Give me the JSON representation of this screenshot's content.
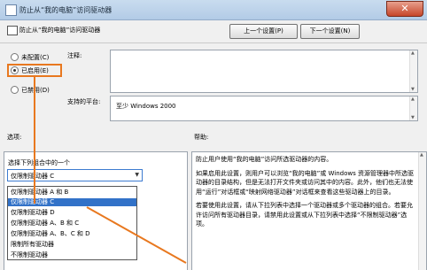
{
  "window": {
    "title": "防止从“我的电脑”访问驱动器",
    "close_glyph": "✕"
  },
  "header": {
    "title": "防止从“我的电脑”访问驱动器"
  },
  "nav": {
    "prev_label": "上一个设置(P)",
    "next_label": "下一个设置(N)"
  },
  "state_options": [
    {
      "label": "未配置(C)",
      "selected": false
    },
    {
      "label": "已启用(E)",
      "selected": true
    },
    {
      "label": "已禁用(D)",
      "selected": false
    }
  ],
  "comment": {
    "label": "注释:",
    "value": ""
  },
  "supported": {
    "label": "支持的平台:",
    "value": "至少 Windows 2000"
  },
  "options_heading": "选项:",
  "help_heading": "帮助:",
  "options": {
    "prompt": "选择下列组合中的一个",
    "selected_value": "仅限制驱动器 C",
    "dropdown_items": [
      "仅限制驱动器 A 和 B",
      "仅限制驱动器 C",
      "仅限制驱动器 D",
      "仅限制驱动器 A、B 和 C",
      "仅限制驱动器 A、B、C 和 D",
      "限制所有驱动器",
      "不限制驱动器"
    ],
    "highlighted_index": 1
  },
  "help": {
    "paragraphs": [
      "防止用户使用“我的电脑”访问所选驱动器的内容。",
      "如果启用此设置，则用户可以浏览“我的电脑”或 Windows 资源管理器中所选驱动器的目录结构，但是无法打开文件夹或访问其中的内容。此外，他们也无法使用“运行”对话框或“映射网络驱动器”对话框来查看这些驱动器上的目录。",
      "若要使用此设置，请从下拉列表中选择一个驱动器或多个驱动器的组合。若要允许访问所有驱动器目录，请禁用此设置或从下拉列表中选择“不限制驱动器”选项。"
    ]
  },
  "colors": {
    "accent": "#e8781f",
    "selection": "#3272c8"
  }
}
